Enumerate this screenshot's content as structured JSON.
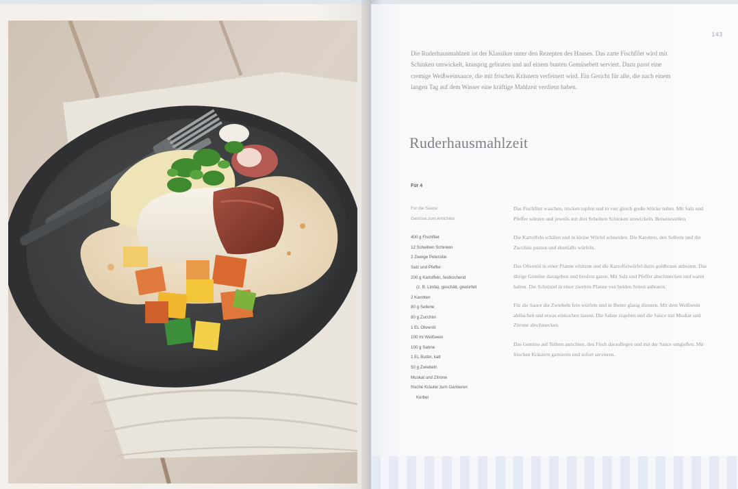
{
  "right_page": {
    "page_number": "143",
    "intro": "Die Ruderhausmahlzeit ist der Klassiker unter den Rezepten des Hauses. Das zarte Fischfilet wird mit Schinken umwickelt, knusprig gebraten und auf einem bunten Gemüsebett serviert. Dazu passt eine cremige Weißweinsauce, die mit frischen Kräutern verfeinert wird. Ein Gericht für alle, die nach einem langen Tag auf dem Wasser eine kräftige Mahlzeit verdient haben.",
    "title": "Ruderhausmahlzeit",
    "servings": "Für 4",
    "ingredients": [
      {
        "text": "Für die Sauce:",
        "style": "light"
      },
      {
        "text": "Gemüse zum Anrichten",
        "style": "light gap"
      },
      {
        "text": "400 g Fischfilet",
        "style": ""
      },
      {
        "text": "12 Scheiben Schinken",
        "style": ""
      },
      {
        "text": "2 Zweige Petersilie",
        "style": ""
      },
      {
        "text": "Salz und Pfeffer",
        "style": ""
      },
      {
        "text": "200 g Kartoffeln, festkochend",
        "style": ""
      },
      {
        "text": "(z. B. Linda), geschält, gewürfelt",
        "style": "indent"
      },
      {
        "text": "2 Karotten",
        "style": ""
      },
      {
        "text": "80 g Sellerie",
        "style": ""
      },
      {
        "text": "80 g Zucchini",
        "style": ""
      },
      {
        "text": "1 EL Olivenöl",
        "style": ""
      },
      {
        "text": "100 ml Weißwein",
        "style": ""
      },
      {
        "text": "100 g Sahne",
        "style": ""
      },
      {
        "text": "1 EL Butter, kalt",
        "style": ""
      },
      {
        "text": "50 g Zwiebeln",
        "style": ""
      },
      {
        "text": "Muskat und Zitrone",
        "style": ""
      },
      {
        "text": "frische Kräuter zum Garnieren",
        "style": ""
      },
      {
        "text": "Kerbel",
        "style": "indent"
      }
    ],
    "steps": [
      "Das Fischfilet waschen, trocken tupfen und in vier gleich große Stücke teilen. Mit Salz und Pfeffer würzen und jeweils mit drei Scheiben Schinken umwickeln. Beiseitestellen.",
      "Die Kartoffeln schälen und in kleine Würfel schneiden. Die Karotten, den Sellerie und die Zucchini putzen und ebenfalls würfeln.",
      "Das Olivenöl in einer Pfanne erhitzen und die Kartoffelwürfel darin goldbraun anbraten. Das übrige Gemüse dazugeben und bissfest garen. Mit Salz und Pfeffer abschmecken und warm halten. Die Schnitzel in einer zweiten Pfanne von beiden Seiten anbraten.",
      "Für die Sauce die Zwiebeln fein würfeln und in Butter glasig dünsten. Mit dem Weißwein ablöschen und etwas einkochen lassen. Die Sahne zugeben und die Sauce mit Muskat und Zitrone abschmecken.",
      "Das Gemüse auf Tellern anrichten, den Fisch darauflegen und mit der Sauce umgießen. Mit frischen Kräutern garnieren und sofort servieren."
    ]
  },
  "colors": {
    "title": "#7c8086",
    "body_text": "#93979c",
    "plate": "#3f4142",
    "sauce": "#efe2cc"
  }
}
